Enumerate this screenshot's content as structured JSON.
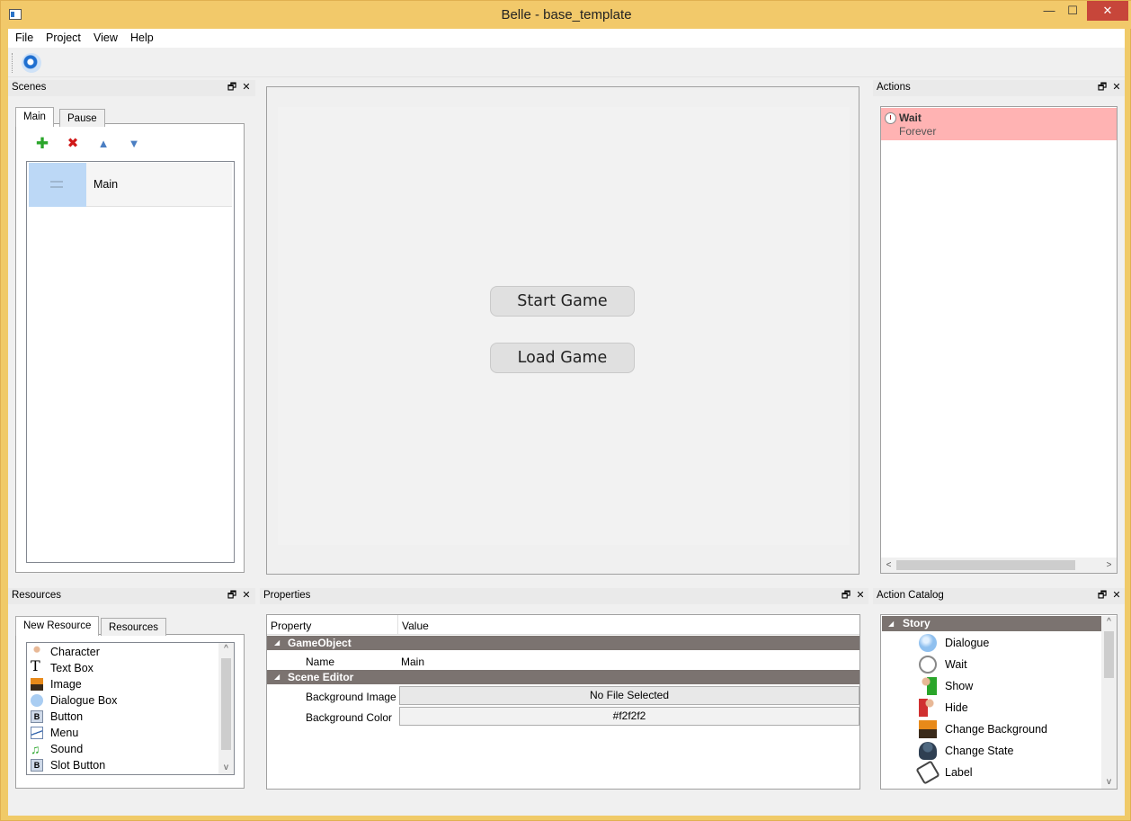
{
  "window": {
    "title": "Belle - base_template",
    "minimize": "—",
    "maximize": "☐",
    "close": "✕"
  },
  "menu": [
    "File",
    "Project",
    "View",
    "Help"
  ],
  "toolbar": {
    "icon": "render-icon"
  },
  "scenes_dock": {
    "title": "Scenes",
    "tabs": [
      "Main",
      "Pause"
    ],
    "buttons": {
      "add": "✚",
      "remove": "✖",
      "up": "▲",
      "down": "▼"
    },
    "items": [
      {
        "label": "Main"
      }
    ]
  },
  "canvas": {
    "background": "#f2f2f2",
    "buttons": [
      "Start Game",
      "Load Game"
    ]
  },
  "actions_dock": {
    "title": "Actions",
    "items": [
      {
        "title": "Wait",
        "subtitle": "Forever",
        "color": "#ffb3b3"
      }
    ]
  },
  "resources_dock": {
    "title": "Resources",
    "tabs": [
      "New Resource",
      "Resources"
    ],
    "items": [
      "Character",
      "Text Box",
      "Image",
      "Dialogue Box",
      "Button",
      "Menu",
      "Sound",
      "Slot Button"
    ]
  },
  "properties_dock": {
    "title": "Properties",
    "columns": [
      "Property",
      "Value"
    ],
    "groups": [
      {
        "name": "GameObject",
        "rows": [
          {
            "key": "Name",
            "value": "Main"
          }
        ]
      },
      {
        "name": "Scene Editor",
        "rows": [
          {
            "key": "Background Image",
            "value": "No File Selected"
          },
          {
            "key": "Background Color",
            "value": "#f2f2f2"
          }
        ]
      }
    ]
  },
  "catalog_dock": {
    "title": "Action Catalog",
    "group": "Story",
    "items": [
      "Dialogue",
      "Wait",
      "Show",
      "Hide",
      "Change Background",
      "Change State",
      "Label"
    ]
  },
  "dock_buttons": {
    "float": "🗗",
    "close": "✕"
  }
}
